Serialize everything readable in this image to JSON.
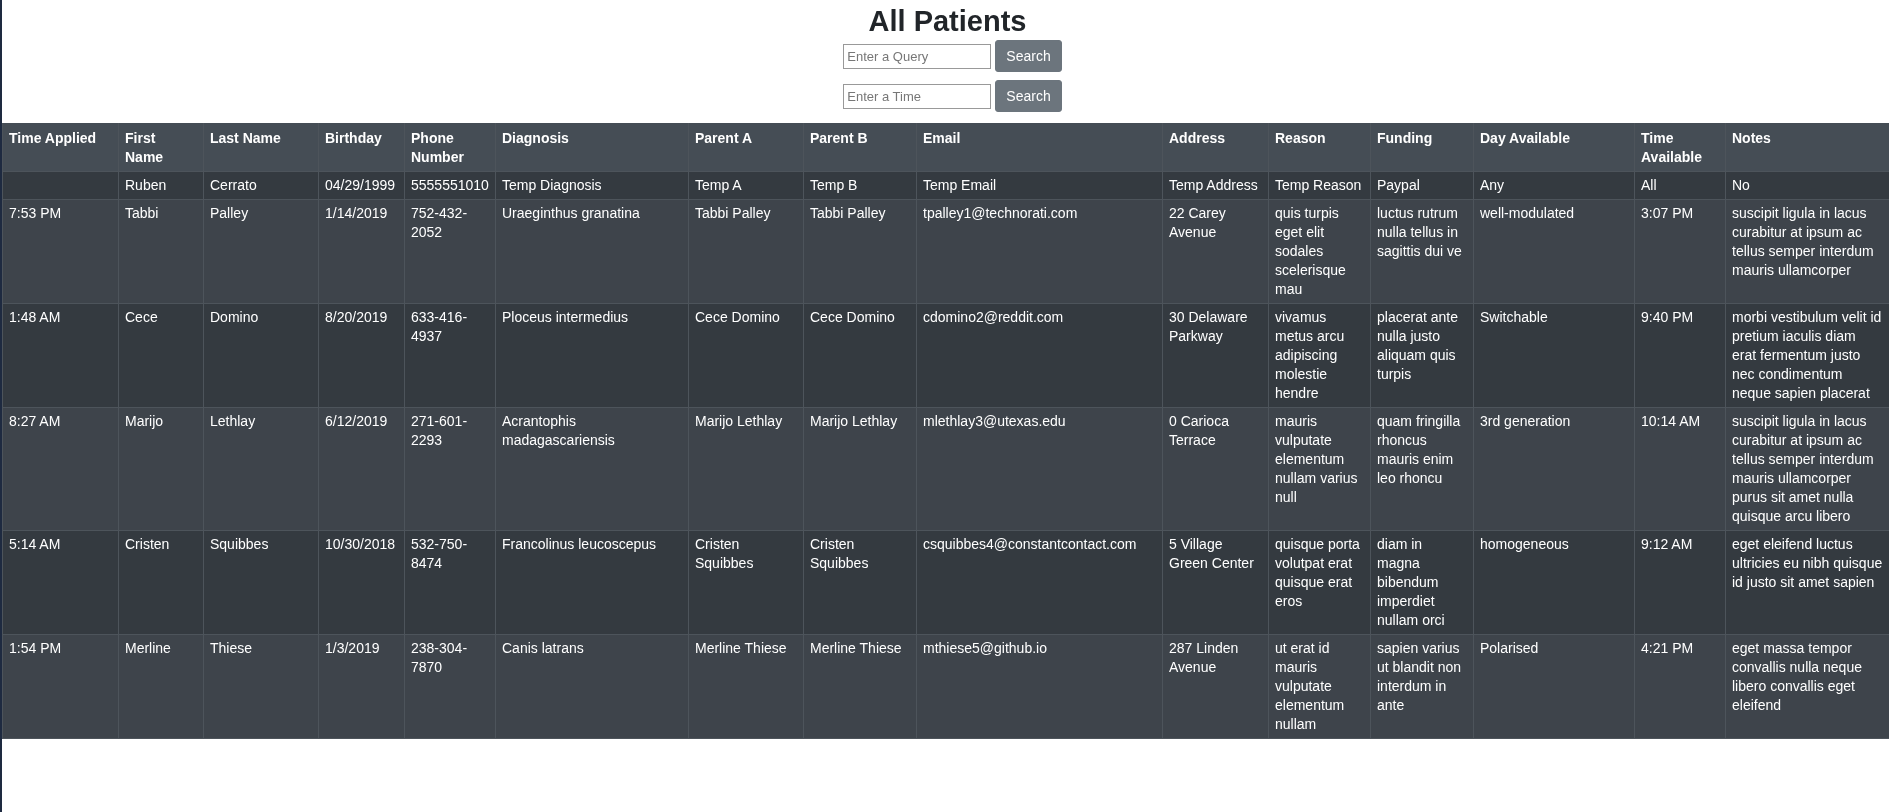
{
  "title": "All Patients",
  "query_search": {
    "placeholder": "Enter a Query",
    "button": "Search"
  },
  "time_search": {
    "placeholder": "Enter a Time",
    "button": "Search"
  },
  "table": {
    "columns": [
      "Time Applied",
      "First Name",
      "Last Name",
      "Birthday",
      "Phone Number",
      "Diagnosis",
      "Parent A",
      "Parent B",
      "Email",
      "Address",
      "Reason",
      "Funding",
      "Day Available",
      "Time Available",
      "Notes"
    ],
    "rows": [
      [
        null,
        "Ruben",
        "Cerrato",
        "04/29/1999",
        "5555551010",
        "Temp Diagnosis",
        "Temp A",
        "Temp B",
        "Temp Email",
        "Temp Address",
        "Temp Reason",
        "Paypal",
        "Any",
        "All",
        "No"
      ],
      [
        "7:53 PM",
        "Tabbi",
        "Palley",
        "1/14/2019",
        "752-432-2052",
        "Uraeginthus granatina",
        "Tabbi Palley",
        "Tabbi Palley",
        "tpalley1@technorati.com",
        "22 Carey Avenue",
        "quis turpis eget elit sodales scelerisque mau",
        "luctus rutrum nulla tellus in sagittis dui ve",
        "well-modulated",
        "3:07 PM",
        "suscipit ligula in lacus curabitur at ipsum ac tellus semper interdum mauris ullamcorper"
      ],
      [
        "1:48 AM",
        "Cece",
        "Domino",
        "8/20/2019",
        "633-416-4937",
        "Ploceus intermedius",
        "Cece Domino",
        "Cece Domino",
        "cdomino2@reddit.com",
        "30 Delaware Parkway",
        "vivamus metus arcu adipiscing molestie hendre",
        "placerat ante nulla justo aliquam quis turpis",
        "Switchable",
        "9:40 PM",
        "morbi vestibulum velit id pretium iaculis diam erat fermentum justo nec condimentum neque sapien placerat"
      ],
      [
        "8:27 AM",
        "Marijo",
        "Lethlay",
        "6/12/2019",
        "271-601-2293",
        "Acrantophis madagascariensis",
        "Marijo Lethlay",
        "Marijo Lethlay",
        "mlethlay3@utexas.edu",
        "0 Carioca Terrace",
        "mauris vulputate elementum nullam varius null",
        "quam fringilla rhoncus mauris enim leo rhoncu",
        "3rd generation",
        "10:14 AM",
        "suscipit ligula in lacus curabitur at ipsum ac tellus semper interdum mauris ullamcorper purus sit amet nulla quisque arcu libero"
      ],
      [
        "5:14 AM",
        "Cristen",
        "Squibbes",
        "10/30/2018",
        "532-750-8474",
        "Francolinus leucoscepus",
        "Cristen Squibbes",
        "Cristen Squibbes",
        "csquibbes4@constantcontact.com",
        "5 Village Green Center",
        "quisque porta volutpat erat quisque erat eros",
        "diam in magna bibendum imperdiet nullam orci",
        "homogeneous",
        "9:12 AM",
        "eget eleifend luctus ultricies eu nibh quisque id justo sit amet sapien"
      ],
      [
        "1:54 PM",
        "Merline",
        "Thiese",
        "1/3/2019",
        "238-304-7870",
        "Canis latrans",
        "Merline Thiese",
        "Merline Thiese",
        "mthiese5@github.io",
        "287 Linden Avenue",
        "ut erat id mauris vulputate elementum nullam",
        "sapien varius ut blandit non interdum in ante",
        "Polarised",
        "4:21 PM",
        "eget massa tempor convallis nulla neque libero convallis eget eleifend"
      ]
    ]
  }
}
